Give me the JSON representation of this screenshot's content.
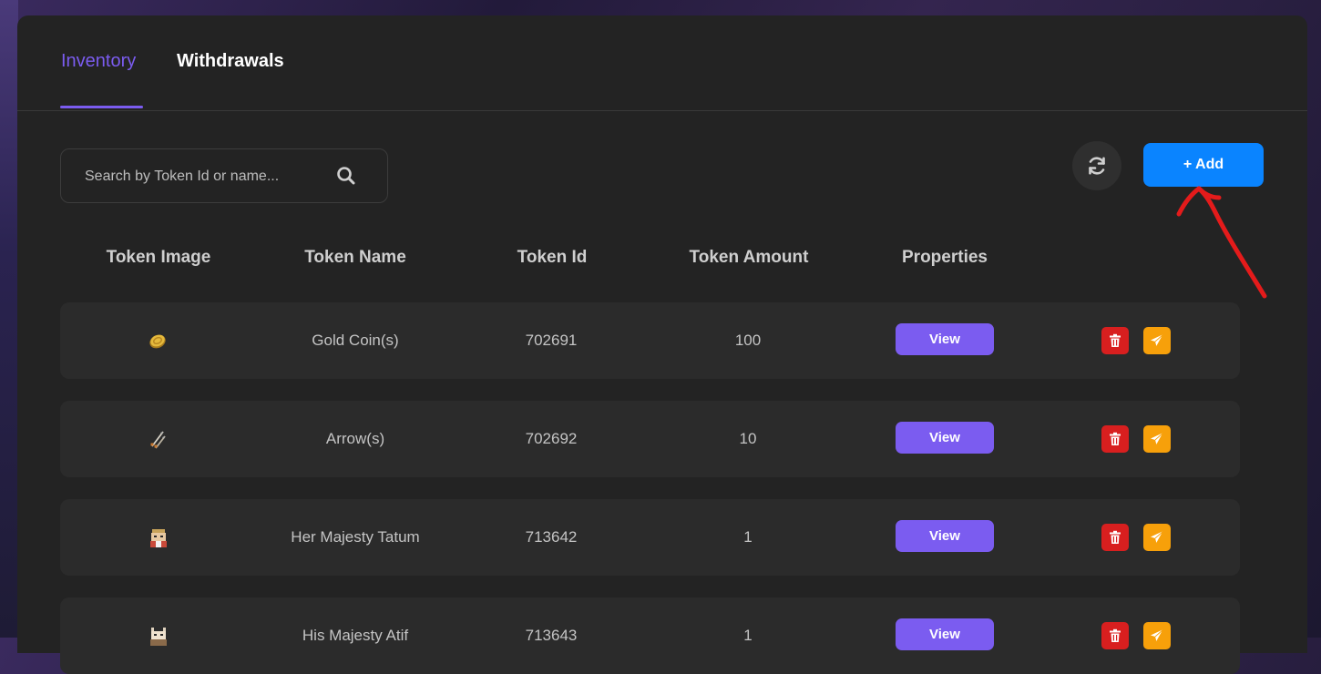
{
  "tabs": [
    {
      "label": "Inventory",
      "active": true
    },
    {
      "label": "Withdrawals",
      "active": false
    }
  ],
  "search": {
    "placeholder": "Search by Token Id or name...",
    "value": ""
  },
  "toolbar": {
    "add_label": "+ Add",
    "refresh_icon": "refresh-icon",
    "search_icon": "search-icon"
  },
  "table": {
    "headers": [
      "Token Image",
      "Token Name",
      "Token Id",
      "Token Amount",
      "Properties"
    ],
    "rows": [
      {
        "icon": "gold-coin-icon",
        "name": "Gold Coin(s)",
        "id": "702691",
        "amount": "100",
        "properties_label": "View"
      },
      {
        "icon": "arrow-icon",
        "name": "Arrow(s)",
        "id": "702692",
        "amount": "10",
        "properties_label": "View"
      },
      {
        "icon": "character-icon",
        "name": "Her Majesty Tatum",
        "id": "713642",
        "amount": "1",
        "properties_label": "View"
      },
      {
        "icon": "character-icon",
        "name": "His Majesty Atif",
        "id": "713643",
        "amount": "1",
        "properties_label": "View"
      }
    ]
  },
  "colors": {
    "accent": "#7b5cf0",
    "add_button": "#0a84ff",
    "delete_button": "#d81f1f",
    "send_button": "#f7a00a",
    "panel": "#232323",
    "annotation": "#e41b1b"
  }
}
